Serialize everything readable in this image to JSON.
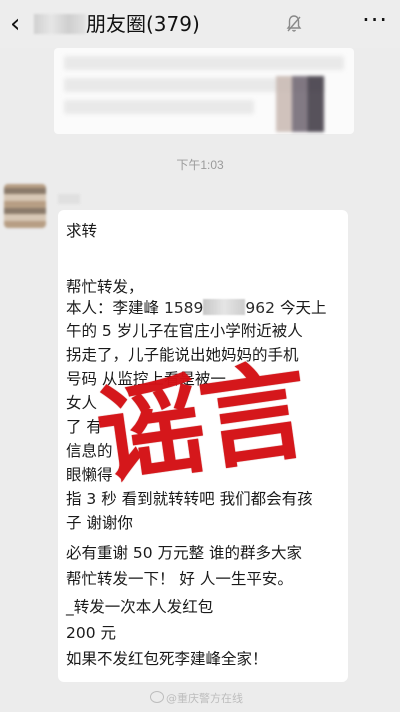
{
  "header": {
    "title": "朋友圈(379)",
    "back_icon": "chevron-left-icon",
    "mute_icon": "bell-muted-icon",
    "more_icon": "more-dots-icon"
  },
  "time_stamp": "下午1:03",
  "message": {
    "lines": [
      "求转",
      "",
      "帮忙转发，",
      "本人：李建峰",
      "今天上",
      "午的 5 岁儿子在官庄小学附近被人",
      "拐走了，儿子能说出她妈妈的手机",
      "号码 从监控上看是被一",
      "女人",
      "了 有",
      "信息的",
      "眼懒得",
      "指 3 秒 看到就转转吧 我们都会有孩",
      "子 谢谢你",
      "必有重谢  50 万元整  谁的群多大家",
      "帮忙转发一下！ 好 人一生平安。",
      "_转发一次本人发红包",
      "200 元",
      "如果不发红包死李建峰全家！"
    ],
    "phone_prefix": "1589",
    "phone_suffix": "962"
  },
  "stamp": {
    "text": "谣言",
    "color": "#d61216"
  },
  "watermark": "@重庆警方在线",
  "colors": {
    "background": "#ececec",
    "bubble": "#ffffff",
    "text": "#1a1a1a",
    "time": "#9b9b9b"
  }
}
